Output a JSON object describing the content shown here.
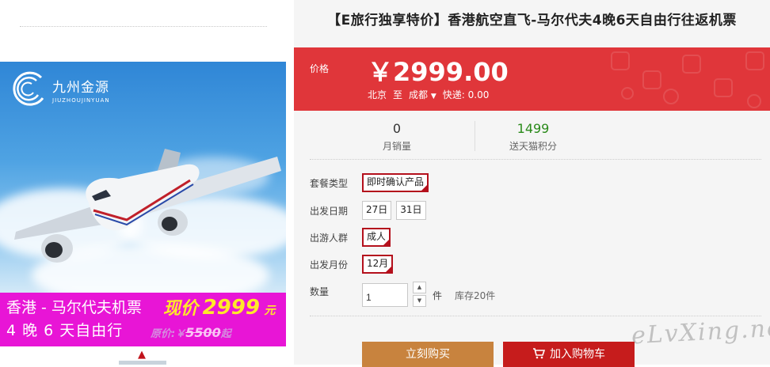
{
  "banner": {
    "brand_cn": "九州金源",
    "brand_en": "JIUZHOUJINYUAN",
    "promo_line1": "香港 - 马尔代夫机票",
    "promo_line2": "4 晚 6 天自由行",
    "promo_price_label": "现价",
    "promo_price_value": "2999",
    "promo_price_unit": "元",
    "promo_orig_label": "原价:￥",
    "promo_orig_value": "5500",
    "promo_orig_suffix": "起"
  },
  "product": {
    "title": "【E旅行独享特价】香港航空直飞-马尔代夫4晚6天自由行往返机票",
    "price_label": "价格",
    "price": "￥2999.00",
    "ship_from": "北京",
    "ship_to_word": "至",
    "ship_dest": "成都",
    "ship_fee": "快递: 0.00"
  },
  "stats": {
    "sales_value": "0",
    "sales_label": "月销量",
    "points_value": "1499",
    "points_label": "送天猫积分"
  },
  "options": {
    "package_label": "套餐类型",
    "package_values": [
      "即时确认产品"
    ],
    "date_label": "出发日期",
    "date_values": [
      "27日",
      "31日"
    ],
    "traveler_label": "出游人群",
    "traveler_values": [
      "成人"
    ],
    "month_label": "出发月份",
    "month_values": [
      "12月"
    ],
    "qty_label": "数量",
    "qty_value": "1",
    "qty_unit": "件",
    "stock": "库存20件"
  },
  "actions": {
    "buy_now": "立刻购买",
    "add_to_cart": "加入购物车"
  },
  "watermark": "eLvXing.net",
  "colors": {
    "price_band": "#e0363a",
    "selected_border": "#b4101c",
    "buy_button": "#c8833e",
    "cart_button": "#c61c1c",
    "promo_bg": "#e815d6",
    "points_green": "#2a8a1a"
  },
  "icons": [
    "caret-up-icon",
    "cart-icon",
    "chevron-down-icon",
    "logo-icon",
    "check-icon"
  ]
}
